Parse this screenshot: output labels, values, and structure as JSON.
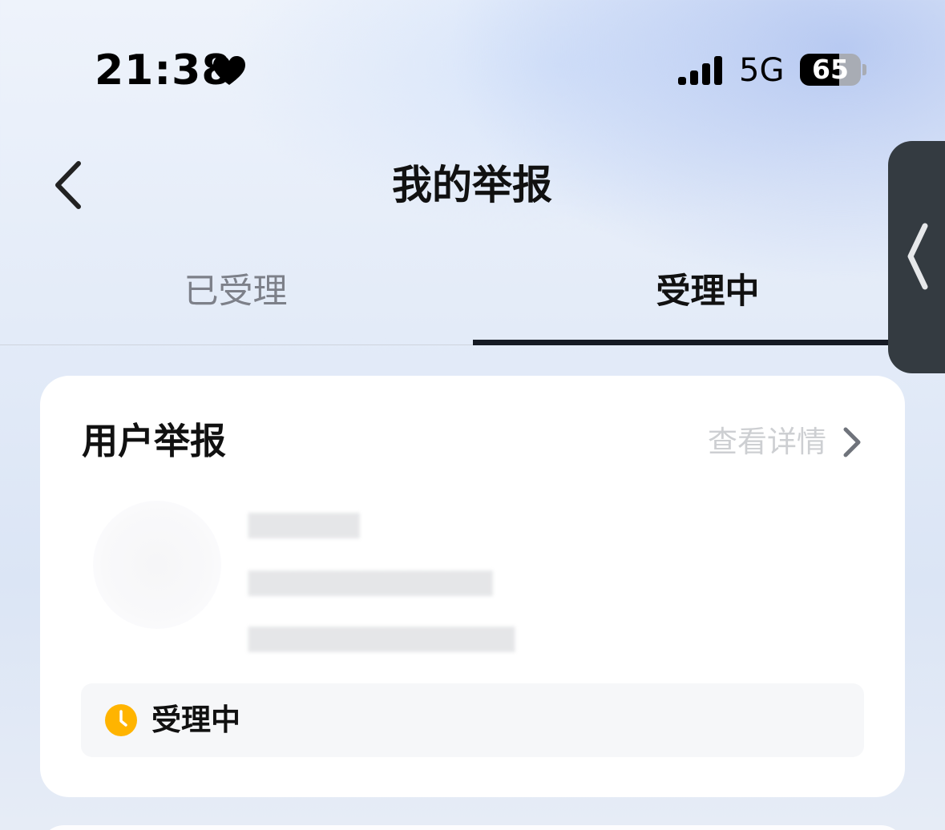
{
  "status_bar": {
    "time": "21:38",
    "network": "5G",
    "battery_level": "65",
    "battery_fraction": 0.65,
    "icons": [
      "heart-icon",
      "signal-icon",
      "battery-icon"
    ]
  },
  "nav": {
    "title": "我的举报",
    "back_icon": "chevron-left-icon"
  },
  "tabs": [
    {
      "label": "已受理",
      "active": false
    },
    {
      "label": "受理中",
      "active": true
    }
  ],
  "report_card": {
    "title": "用户举报",
    "detail_label": "查看详情",
    "status": "受理中",
    "status_icon": "clock-icon"
  },
  "colors": {
    "accent_dark": "#151a24",
    "status_yellow": "#ffb400",
    "side_handle": "#343b41"
  }
}
